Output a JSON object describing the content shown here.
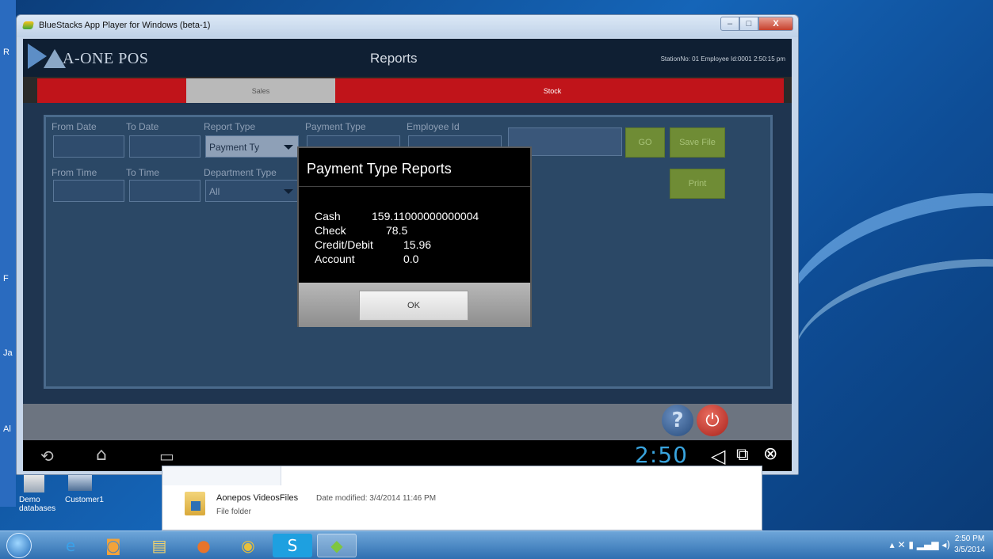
{
  "window": {
    "title": "BlueStacks App Player for Windows (beta-1)",
    "min": "–",
    "max": "□",
    "close": "X"
  },
  "app": {
    "logo": "A-ONE POS",
    "title": "Reports",
    "station_info": "StationNo: 01  Employee Id:0001   2:50:15 pm"
  },
  "tabs": [
    {
      "label": "Sales"
    },
    {
      "label": "Stock"
    }
  ],
  "filters": {
    "from_date": "From Date",
    "to_date": "To Date",
    "report_type": "Report Type",
    "report_type_value": "Payment Ty",
    "payment_type": "Payment Type",
    "employee_id": "Employee Id",
    "from_time": "From Time",
    "to_time": "To Time",
    "department_type": "Department Type",
    "department_value": "All"
  },
  "buttons": {
    "go": "GO",
    "save_file": "Save File",
    "print": "Print"
  },
  "dialog": {
    "title": "Payment Type Reports",
    "rows": [
      {
        "label": "Cash",
        "value": "159.11000000000004"
      },
      {
        "label": "Check",
        "value": "78.5"
      },
      {
        "label": "Credit/Debit",
        "value": "15.96"
      },
      {
        "label": "Account",
        "value": "0.0"
      }
    ],
    "ok": "OK"
  },
  "android_nav": {
    "clock": "2:50"
  },
  "desktop": {
    "left_letters": [
      "R",
      "F",
      "Ja",
      "Al"
    ],
    "icons": [
      {
        "label": "Demo databases"
      },
      {
        "label": "Customer1"
      }
    ]
  },
  "explorer": {
    "name": "Aonepos VideosFiles",
    "date_label": "Date modified: 3/4/2014 11:46 PM",
    "type": "File folder"
  },
  "taskbar": {
    "time": "2:50 PM",
    "date": "3/5/2014"
  },
  "colors": {
    "tab_bar": "#c0141a",
    "accent_green": "#6f8c35",
    "clock_blue": "#39a4de"
  }
}
